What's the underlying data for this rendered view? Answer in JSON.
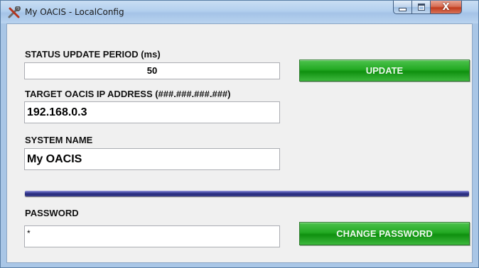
{
  "window": {
    "title": "My OACIS - LocalConfig",
    "app_icon": "tools-icon",
    "controls": {
      "minimize_icon": "minimize-icon",
      "maximize_icon": "maximize-icon",
      "close_icon": "close-icon",
      "close_glyph": "X"
    }
  },
  "status": {
    "label": "STATUS UPDATE PERIOD (ms)",
    "value": "50",
    "update_button": "UPDATE"
  },
  "target_ip": {
    "label": "TARGET OACIS IP ADDRESS (###.###.###.###)",
    "value": "192.168.0.3"
  },
  "system_name": {
    "label": "SYSTEM NAME",
    "value": "My OACIS"
  },
  "password": {
    "label": "PASSWORD",
    "value": "*",
    "change_button": "CHANGE PASSWORD"
  },
  "colors": {
    "button_green": "#1fa01f",
    "divider_navy": "#2b2f80",
    "titlebar_blue": "#b3cfee",
    "close_red": "#c13c1e"
  }
}
